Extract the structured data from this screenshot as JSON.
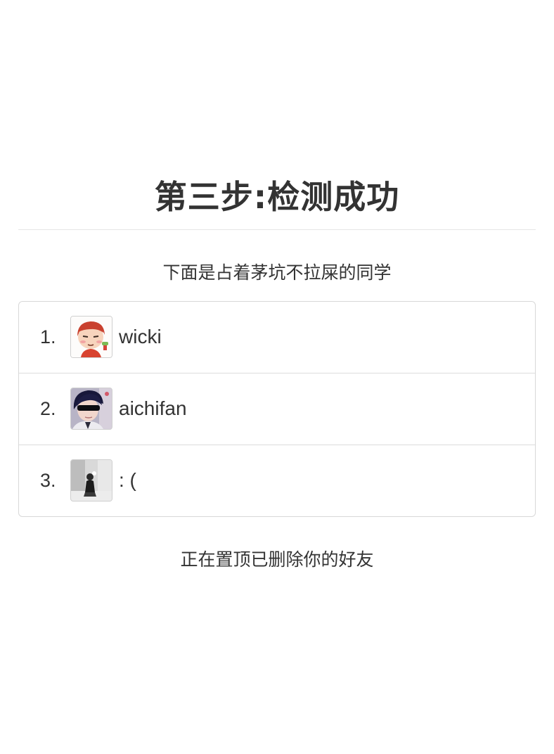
{
  "header": {
    "title": "第三步:检测成功"
  },
  "subtitle": "下面是占着茅坑不拉屎的同学",
  "friends": [
    {
      "index": "1.",
      "name": "wicki",
      "avatar_icon": "cartoon-boy-avatar-icon"
    },
    {
      "index": "2.",
      "name": "aichifan",
      "avatar_icon": "anime-man-sunglasses-avatar-icon"
    },
    {
      "index": "3.",
      "name": ": (",
      "avatar_icon": "person-photo-avatar-icon"
    }
  ],
  "footer": {
    "status": "正在置顶已删除你的好友"
  }
}
